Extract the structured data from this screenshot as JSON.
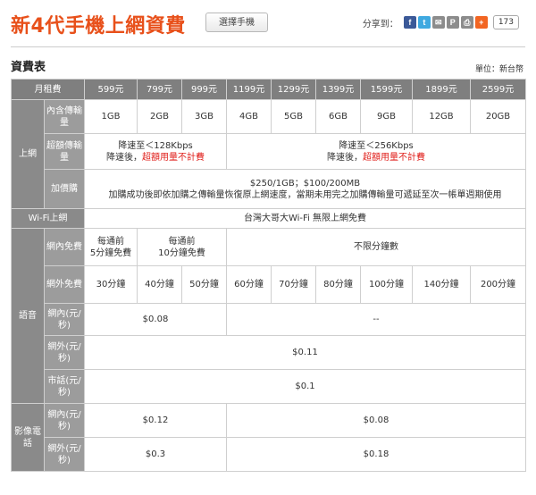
{
  "header": {
    "title": "新4代手機上網資費",
    "choose_phone_label": "選擇手機"
  },
  "share": {
    "label": "分享到：",
    "count": "173",
    "icons": [
      "facebook-icon",
      "twitter-icon",
      "email-icon",
      "plurk-icon",
      "print-icon",
      "plus-icon"
    ],
    "icon_colors": [
      "#3b5998",
      "#3fa9e0",
      "#8c8c8c",
      "#8c8c8c",
      "#8c8c8c",
      "#f26522"
    ],
    "icon_glyphs": [
      "f",
      "t",
      "✉",
      "P",
      "⎙",
      "+"
    ]
  },
  "section": {
    "title": "資費表",
    "unit": "單位：新台幣"
  },
  "table": {
    "monthly_label": "月租費",
    "plans": [
      "599元",
      "799元",
      "999元",
      "1199元",
      "1299元",
      "1399元",
      "1599元",
      "1899元",
      "2599元"
    ],
    "data_label": "上網",
    "data_included_label": "內含傳輸量",
    "data_included": [
      "1GB",
      "2GB",
      "3GB",
      "4GB",
      "5GB",
      "6GB",
      "9GB",
      "12GB",
      "20GB"
    ],
    "overage_label": "超額傳輸量",
    "overage_low": {
      "line1": "降速至＜128Kbps",
      "line2_prefix": "降速後，",
      "line2_red": "超額用量不計費"
    },
    "overage_high": {
      "line1": "降速至＜256Kbps",
      "line2_prefix": "降速後，",
      "line2_red": "超額用量不計費"
    },
    "addon_label": "加價購",
    "addon_line1": "$250/1GB；$100/200MB",
    "addon_line2": "加購成功後即依加購之傳輸量恢復原上網速度，當期未用完之加購傳輸量可遞延至次一帳單週期使用",
    "wifi_label": "Wi-Fi上網",
    "wifi_value": "台灣大哥大Wi-Fi 無限上網免費",
    "voice_label": "語音",
    "onnet_free_label": "網內免費",
    "onnet_free_a": {
      "line1": "每通前",
      "line2": "5分鐘免費"
    },
    "onnet_free_b": {
      "line1": "每通前",
      "line2": "10分鐘免費"
    },
    "onnet_free_unlimited": "不限分鐘數",
    "offnet_free_label": "網外免費",
    "offnet_free": [
      "30分鐘",
      "40分鐘",
      "50分鐘",
      "60分鐘",
      "70分鐘",
      "80分鐘",
      "100分鐘",
      "140分鐘",
      "200分鐘"
    ],
    "onnet_rate_label": "網內(元/秒)",
    "onnet_rate_low": "$0.08",
    "onnet_rate_high": "--",
    "offnet_rate_label": "網外(元/秒)",
    "offnet_rate": "$0.11",
    "local_label": "市話(元/秒)",
    "local_rate": "$0.1",
    "video_label": "影像電話",
    "video_onnet_label": "網內(元/秒)",
    "video_onnet_low": "$0.12",
    "video_onnet_high": "$0.08",
    "video_offnet_label": "網外(元/秒)",
    "video_offnet_low": "$0.3",
    "video_offnet_high": "$0.18"
  }
}
